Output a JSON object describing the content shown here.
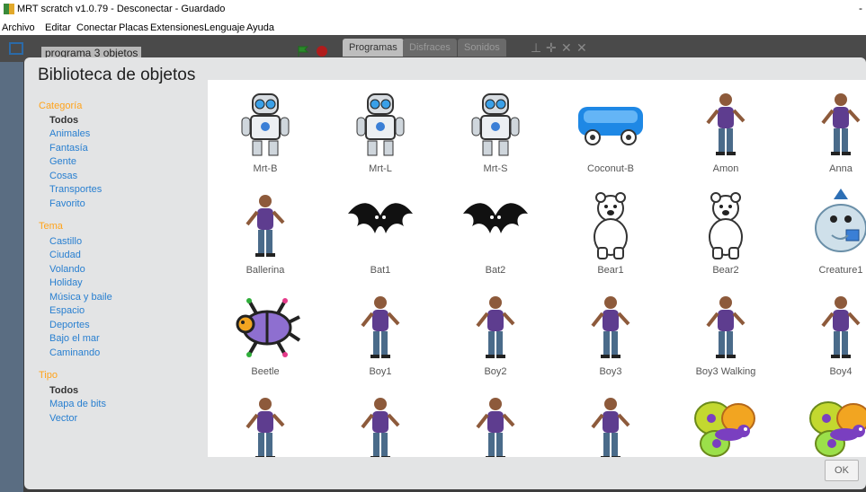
{
  "window": {
    "title": "MRT scratch v1.0.79 - Desconectar - Guardado"
  },
  "menu": [
    "Archivo",
    "Editar",
    "Conectar",
    "Placas",
    "Extensiones",
    "Lenguaje",
    "Ayuda"
  ],
  "background": {
    "project_name": "programa 3 objetos",
    "tabs": [
      "Programas",
      "Disfraces",
      "Sonidos"
    ]
  },
  "dialog": {
    "title": "Biblioteca de objetos",
    "ok_label": "OK",
    "filters": {
      "categoria": {
        "heading": "Categoría",
        "items": [
          "Todos",
          "Animales",
          "Fantasía",
          "Gente",
          "Cosas",
          "Transportes",
          "Favorito"
        ],
        "selected": "Todos"
      },
      "tema": {
        "heading": "Tema",
        "items": [
          "Castillo",
          "Ciudad",
          "Volando",
          "Holiday",
          "Música y baile",
          "Espacio",
          "Deportes",
          "Bajo el mar",
          "Caminando"
        ]
      },
      "tipo": {
        "heading": "Tipo",
        "items": [
          "Todos",
          "Mapa de bits",
          "Vector"
        ],
        "selected": "Todos"
      }
    },
    "sprites": [
      {
        "name": "Mrt-B",
        "icon": "robot-icon"
      },
      {
        "name": "Mrt-L",
        "icon": "robot-icon"
      },
      {
        "name": "Mrt-S",
        "icon": "robot-icon"
      },
      {
        "name": "Coconut-B",
        "icon": "vehicle-icon"
      },
      {
        "name": "Amon",
        "icon": "person-icon"
      },
      {
        "name": "Anna",
        "icon": "person-icon"
      },
      {
        "name": "Ballerina",
        "icon": "person-icon"
      },
      {
        "name": "Bat1",
        "icon": "bat-icon"
      },
      {
        "name": "Bat2",
        "icon": "bat-icon"
      },
      {
        "name": "Bear1",
        "icon": "bear-icon"
      },
      {
        "name": "Bear2",
        "icon": "bear-icon"
      },
      {
        "name": "Creature1",
        "icon": "creature-icon"
      },
      {
        "name": "Beetle",
        "icon": "beetle-icon"
      },
      {
        "name": "Boy1",
        "icon": "person-icon"
      },
      {
        "name": "Boy2",
        "icon": "person-icon"
      },
      {
        "name": "Boy3",
        "icon": "person-icon"
      },
      {
        "name": "Boy3 Walking",
        "icon": "person-icon"
      },
      {
        "name": "Boy4",
        "icon": "person-icon"
      },
      {
        "name": "",
        "icon": "person-icon"
      },
      {
        "name": "",
        "icon": "person-icon"
      },
      {
        "name": "",
        "icon": "person-icon"
      },
      {
        "name": "",
        "icon": "person-icon"
      },
      {
        "name": "",
        "icon": "butterfly-icon"
      },
      {
        "name": "",
        "icon": "butterfly-icon"
      }
    ]
  }
}
